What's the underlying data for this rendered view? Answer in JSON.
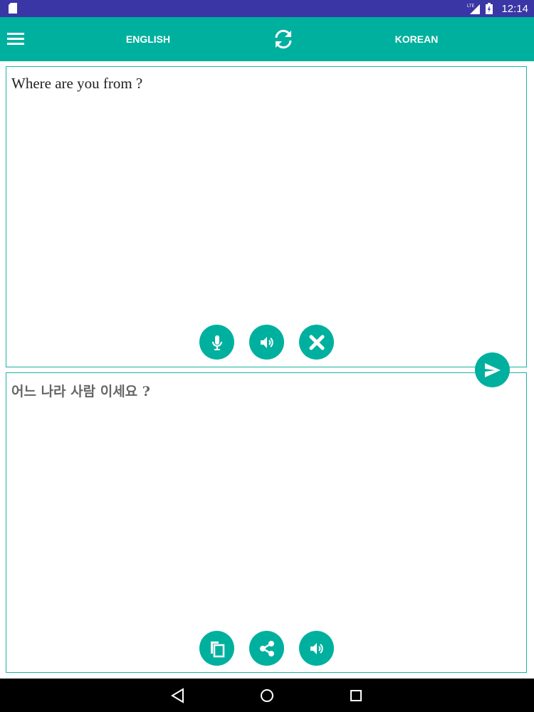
{
  "status_bar": {
    "network_label": "LTE",
    "time": "12:14"
  },
  "app_bar": {
    "menu_icon": "menu-icon",
    "source_language": "ENGLISH",
    "swap_icon": "swap-icon",
    "target_language": "KOREAN"
  },
  "source_panel": {
    "text": "Where are you from ?",
    "buttons": [
      "microphone-icon",
      "speaker-icon",
      "clear-icon"
    ]
  },
  "translate_button": {
    "icon": "send-icon"
  },
  "target_panel": {
    "text": "어느 나라 사람 이세요 ?",
    "buttons": [
      "copy-icon",
      "share-icon",
      "speaker-icon"
    ]
  },
  "nav_bar": {
    "buttons": [
      "back-icon",
      "home-icon",
      "recents-icon"
    ]
  },
  "colors": {
    "status_bar": "#3a36a5",
    "accent": "#00b09e",
    "panel_border": "#1fb3a3",
    "nav_bar": "#000000"
  }
}
